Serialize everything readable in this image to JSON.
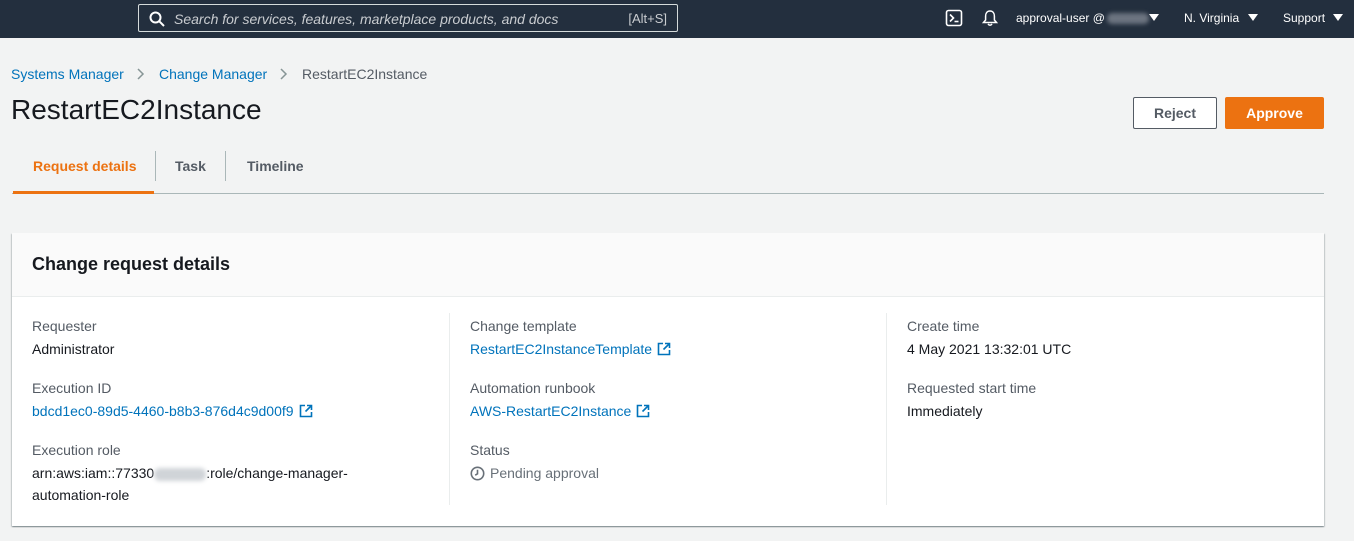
{
  "topnav": {
    "search_placeholder": "Search for services, features, marketplace products, and docs",
    "search_shortcut": "[Alt+S]",
    "account": "approval-user @",
    "region": "N. Virginia",
    "support": "Support"
  },
  "breadcrumb": {
    "items": [
      "Systems Manager",
      "Change Manager",
      "RestartEC2Instance"
    ]
  },
  "page": {
    "title": "RestartEC2Instance",
    "reject_label": "Reject",
    "approve_label": "Approve"
  },
  "tabs": [
    "Request details",
    "Task",
    "Timeline"
  ],
  "details": {
    "heading": "Change request details",
    "requester_label": "Requester",
    "requester_value": "Administrator",
    "execution_id_label": "Execution ID",
    "execution_id_value": "bdcd1ec0-89d5-4460-b8b3-876d4c9d00f9",
    "execution_role_label": "Execution role",
    "execution_role_prefix": "arn:aws:iam::77330",
    "execution_role_suffix": ":role/change-manager-",
    "execution_role_line2": "automation-role",
    "change_template_label": "Change template",
    "change_template_value": "RestartEC2InstanceTemplate",
    "automation_runbook_label": "Automation runbook",
    "automation_runbook_value": "AWS-RestartEC2Instance",
    "status_label": "Status",
    "status_value": "Pending approval",
    "create_time_label": "Create time",
    "create_time_value": "4 May 2021 13:32:01 UTC",
    "requested_start_label": "Requested start time",
    "requested_start_value": "Immediately"
  },
  "colors": {
    "nav_bg": "#232f3e",
    "accent_orange": "#ec7211",
    "link_blue": "#0073bb"
  }
}
